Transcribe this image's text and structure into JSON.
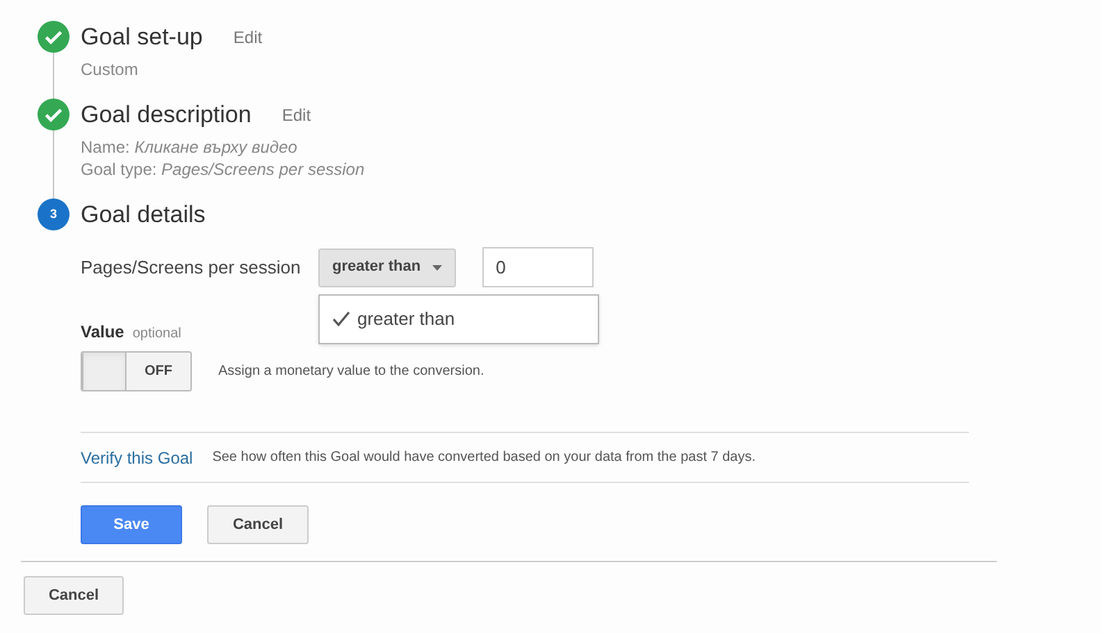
{
  "steps": [
    {
      "kind": "done",
      "title": "Goal set-up",
      "edit": "Edit",
      "lines": [
        {
          "value": "Custom"
        }
      ]
    },
    {
      "kind": "done",
      "title": "Goal description",
      "edit": "Edit",
      "lines": [
        {
          "label": "Name:",
          "value": "Кликане върху видео"
        },
        {
          "label": "Goal type:",
          "value": "Pages/Screens per session"
        }
      ]
    },
    {
      "kind": "current",
      "number": "3",
      "title": "Goal details"
    }
  ],
  "condition": {
    "label": "Pages/Screens per session",
    "operator": "greater than",
    "value": "0",
    "menu_open": true,
    "options": [
      {
        "label": "greater than",
        "selected": true
      }
    ]
  },
  "value_field": {
    "label": "Value",
    "hint": "optional",
    "toggle": {
      "on": false,
      "label": "OFF"
    },
    "description": "Assign a monetary value to the conversion."
  },
  "verify": {
    "link": "Verify this Goal",
    "description": "See how often this Goal would have converted based on your data from the past 7 days."
  },
  "buttons": [
    "Save",
    "Cancel"
  ],
  "footer_button": "Cancel"
}
